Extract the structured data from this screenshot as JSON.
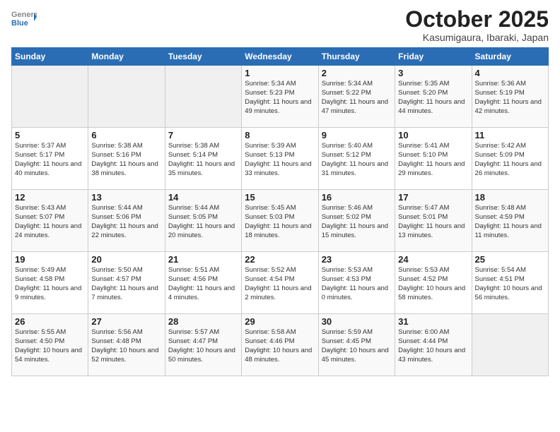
{
  "header": {
    "logo_general": "General",
    "logo_blue": "Blue",
    "month_title": "October 2025",
    "location": "Kasumigaura, Ibaraki, Japan"
  },
  "weekdays": [
    "Sunday",
    "Monday",
    "Tuesday",
    "Wednesday",
    "Thursday",
    "Friday",
    "Saturday"
  ],
  "weeks": [
    [
      {
        "day": "",
        "empty": true
      },
      {
        "day": "",
        "empty": true
      },
      {
        "day": "",
        "empty": true
      },
      {
        "day": "1",
        "sunrise": "Sunrise: 5:34 AM",
        "sunset": "Sunset: 5:23 PM",
        "daylight": "Daylight: 11 hours and 49 minutes."
      },
      {
        "day": "2",
        "sunrise": "Sunrise: 5:34 AM",
        "sunset": "Sunset: 5:22 PM",
        "daylight": "Daylight: 11 hours and 47 minutes."
      },
      {
        "day": "3",
        "sunrise": "Sunrise: 5:35 AM",
        "sunset": "Sunset: 5:20 PM",
        "daylight": "Daylight: 11 hours and 44 minutes."
      },
      {
        "day": "4",
        "sunrise": "Sunrise: 5:36 AM",
        "sunset": "Sunset: 5:19 PM",
        "daylight": "Daylight: 11 hours and 42 minutes."
      }
    ],
    [
      {
        "day": "5",
        "sunrise": "Sunrise: 5:37 AM",
        "sunset": "Sunset: 5:17 PM",
        "daylight": "Daylight: 11 hours and 40 minutes."
      },
      {
        "day": "6",
        "sunrise": "Sunrise: 5:38 AM",
        "sunset": "Sunset: 5:16 PM",
        "daylight": "Daylight: 11 hours and 38 minutes."
      },
      {
        "day": "7",
        "sunrise": "Sunrise: 5:38 AM",
        "sunset": "Sunset: 5:14 PM",
        "daylight": "Daylight: 11 hours and 35 minutes."
      },
      {
        "day": "8",
        "sunrise": "Sunrise: 5:39 AM",
        "sunset": "Sunset: 5:13 PM",
        "daylight": "Daylight: 11 hours and 33 minutes."
      },
      {
        "day": "9",
        "sunrise": "Sunrise: 5:40 AM",
        "sunset": "Sunset: 5:12 PM",
        "daylight": "Daylight: 11 hours and 31 minutes."
      },
      {
        "day": "10",
        "sunrise": "Sunrise: 5:41 AM",
        "sunset": "Sunset: 5:10 PM",
        "daylight": "Daylight: 11 hours and 29 minutes."
      },
      {
        "day": "11",
        "sunrise": "Sunrise: 5:42 AM",
        "sunset": "Sunset: 5:09 PM",
        "daylight": "Daylight: 11 hours and 26 minutes."
      }
    ],
    [
      {
        "day": "12",
        "sunrise": "Sunrise: 5:43 AM",
        "sunset": "Sunset: 5:07 PM",
        "daylight": "Daylight: 11 hours and 24 minutes."
      },
      {
        "day": "13",
        "sunrise": "Sunrise: 5:44 AM",
        "sunset": "Sunset: 5:06 PM",
        "daylight": "Daylight: 11 hours and 22 minutes."
      },
      {
        "day": "14",
        "sunrise": "Sunrise: 5:44 AM",
        "sunset": "Sunset: 5:05 PM",
        "daylight": "Daylight: 11 hours and 20 minutes."
      },
      {
        "day": "15",
        "sunrise": "Sunrise: 5:45 AM",
        "sunset": "Sunset: 5:03 PM",
        "daylight": "Daylight: 11 hours and 18 minutes."
      },
      {
        "day": "16",
        "sunrise": "Sunrise: 5:46 AM",
        "sunset": "Sunset: 5:02 PM",
        "daylight": "Daylight: 11 hours and 15 minutes."
      },
      {
        "day": "17",
        "sunrise": "Sunrise: 5:47 AM",
        "sunset": "Sunset: 5:01 PM",
        "daylight": "Daylight: 11 hours and 13 minutes."
      },
      {
        "day": "18",
        "sunrise": "Sunrise: 5:48 AM",
        "sunset": "Sunset: 4:59 PM",
        "daylight": "Daylight: 11 hours and 11 minutes."
      }
    ],
    [
      {
        "day": "19",
        "sunrise": "Sunrise: 5:49 AM",
        "sunset": "Sunset: 4:58 PM",
        "daylight": "Daylight: 11 hours and 9 minutes."
      },
      {
        "day": "20",
        "sunrise": "Sunrise: 5:50 AM",
        "sunset": "Sunset: 4:57 PM",
        "daylight": "Daylight: 11 hours and 7 minutes."
      },
      {
        "day": "21",
        "sunrise": "Sunrise: 5:51 AM",
        "sunset": "Sunset: 4:56 PM",
        "daylight": "Daylight: 11 hours and 4 minutes."
      },
      {
        "day": "22",
        "sunrise": "Sunrise: 5:52 AM",
        "sunset": "Sunset: 4:54 PM",
        "daylight": "Daylight: 11 hours and 2 minutes."
      },
      {
        "day": "23",
        "sunrise": "Sunrise: 5:53 AM",
        "sunset": "Sunset: 4:53 PM",
        "daylight": "Daylight: 11 hours and 0 minutes."
      },
      {
        "day": "24",
        "sunrise": "Sunrise: 5:53 AM",
        "sunset": "Sunset: 4:52 PM",
        "daylight": "Daylight: 10 hours and 58 minutes."
      },
      {
        "day": "25",
        "sunrise": "Sunrise: 5:54 AM",
        "sunset": "Sunset: 4:51 PM",
        "daylight": "Daylight: 10 hours and 56 minutes."
      }
    ],
    [
      {
        "day": "26",
        "sunrise": "Sunrise: 5:55 AM",
        "sunset": "Sunset: 4:50 PM",
        "daylight": "Daylight: 10 hours and 54 minutes."
      },
      {
        "day": "27",
        "sunrise": "Sunrise: 5:56 AM",
        "sunset": "Sunset: 4:48 PM",
        "daylight": "Daylight: 10 hours and 52 minutes."
      },
      {
        "day": "28",
        "sunrise": "Sunrise: 5:57 AM",
        "sunset": "Sunset: 4:47 PM",
        "daylight": "Daylight: 10 hours and 50 minutes."
      },
      {
        "day": "29",
        "sunrise": "Sunrise: 5:58 AM",
        "sunset": "Sunset: 4:46 PM",
        "daylight": "Daylight: 10 hours and 48 minutes."
      },
      {
        "day": "30",
        "sunrise": "Sunrise: 5:59 AM",
        "sunset": "Sunset: 4:45 PM",
        "daylight": "Daylight: 10 hours and 45 minutes."
      },
      {
        "day": "31",
        "sunrise": "Sunrise: 6:00 AM",
        "sunset": "Sunset: 4:44 PM",
        "daylight": "Daylight: 10 hours and 43 minutes."
      },
      {
        "day": "",
        "empty": true
      }
    ]
  ]
}
